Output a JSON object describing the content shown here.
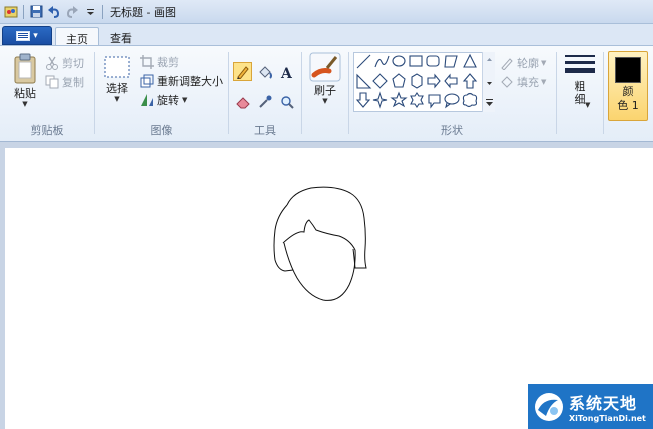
{
  "window": {
    "title": "无标题 - 画图"
  },
  "tabs": {
    "file_icon": "▾",
    "home": "主页",
    "view": "查看"
  },
  "clipboard": {
    "paste": "粘贴",
    "cut": "剪切",
    "copy": "复制",
    "label": "剪贴板"
  },
  "image": {
    "select": "选择",
    "crop": "裁剪",
    "resize": "重新调整大小",
    "rotate": "旋转",
    "label": "图像"
  },
  "tools": {
    "label": "工具",
    "brush": "刷子"
  },
  "shapes": {
    "outline": "轮廓",
    "fill": "填充",
    "label": "形状"
  },
  "size": {
    "label": "粗\n细"
  },
  "color": {
    "label_line1": "颜",
    "label_line2": "色 1",
    "value": "#000000"
  },
  "watermark": {
    "main": "系统天地",
    "sub": "XiTongTianDi.net"
  },
  "colors": {
    "accent": "#2b6ac4",
    "ribbon": "#e4edf8",
    "selected": "#fbd46f"
  }
}
